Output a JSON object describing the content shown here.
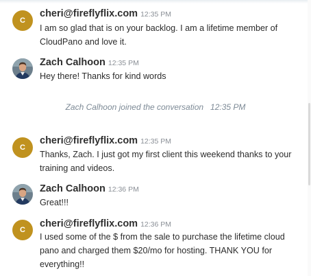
{
  "messages": [
    {
      "sender": "cheri@fireflyflix.com",
      "time": "12:35 PM",
      "avatar_letter": "C",
      "text": "I am so glad that is on your backlog. I am a lifetime member of CloudPano and love it."
    },
    {
      "sender": "Zach Calhoon",
      "time": "12:35 PM",
      "text": "Hey there! Thanks for kind words"
    },
    {
      "sender": "cheri@fireflyflix.com",
      "time": "12:35 PM",
      "avatar_letter": "C",
      "text": "Thanks, Zach. I just got my first client this weekend thanks to your training and videos."
    },
    {
      "sender": "Zach Calhoon",
      "time": "12:36 PM",
      "text": "Great!!!"
    },
    {
      "sender": "cheri@fireflyflix.com",
      "time": "12:36 PM",
      "avatar_letter": "C",
      "text": "I used some of the $ from the sale to purchase the lifetime cloud pano and charged them $20/mo for hosting. THANK YOU for everything!!"
    }
  ],
  "system_event": {
    "text": "Zach Calhoon joined the conversation",
    "time": "12:35 PM"
  },
  "colors": {
    "avatar_letter_bg": "#c0921f",
    "system_text": "#7d8a96",
    "timestamp": "#8a8f96"
  }
}
